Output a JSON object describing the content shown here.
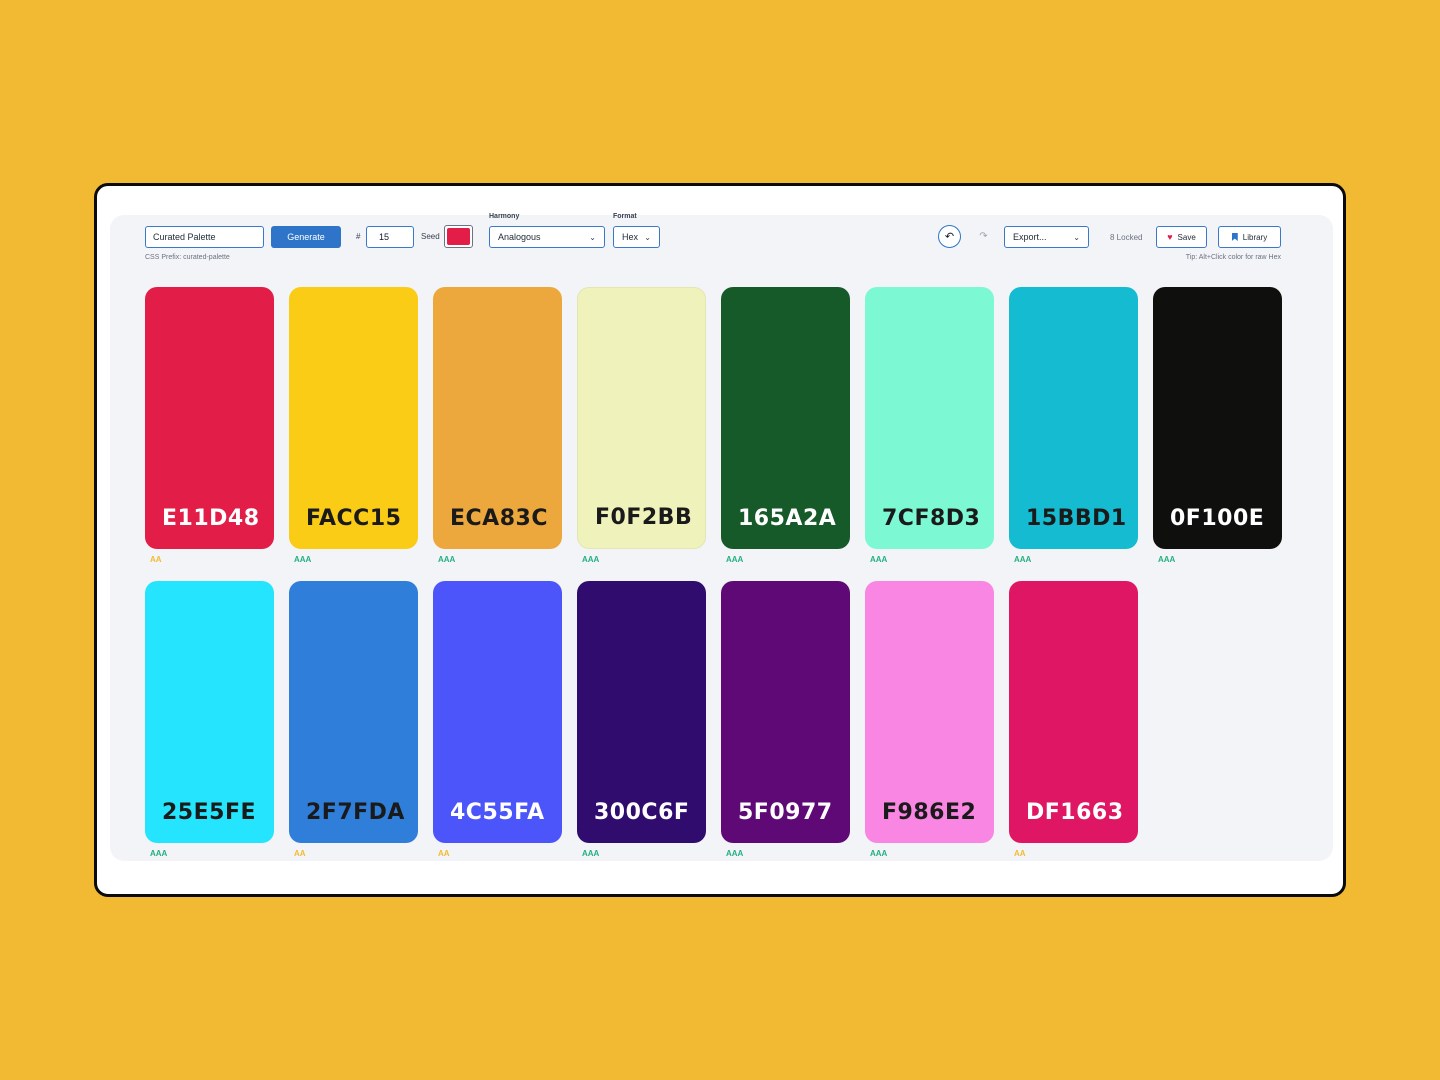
{
  "toolbar": {
    "name_value": "Curated Palette",
    "prefix_note": "CSS Prefix: curated-palette",
    "generate_label": "Generate",
    "count_label": "#",
    "count_value": "15",
    "seed_label": "Seed",
    "seed_color": "#E11D48",
    "harmony_label": "Harmony",
    "harmony_value": "Analogous",
    "format_label": "Format",
    "format_value": "Hex",
    "export_value": "Export...",
    "locked_text": "8 Locked",
    "save_label": "Save",
    "library_label": "Library",
    "tip": "Tip: Alt+Click color for raw Hex"
  },
  "colors": {
    "accent": "#2E74C9",
    "aa_color": "#F2BA33",
    "aaa_color": "#22B07D"
  },
  "swatches": [
    {
      "hex": "E11D48",
      "color": "#E11D48",
      "text_color": "#ffffff",
      "rating": "AA"
    },
    {
      "hex": "FACC15",
      "color": "#FACC15",
      "text_color": "#1a1a1a",
      "rating": "AAA"
    },
    {
      "hex": "ECA83C",
      "color": "#ECA83C",
      "text_color": "#1a1a1a",
      "rating": "AAA"
    },
    {
      "hex": "F0F2BB",
      "color": "#F0F2BB",
      "text_color": "#1a1a1a",
      "rating": "AAA"
    },
    {
      "hex": "165A2A",
      "color": "#165A2A",
      "text_color": "#ffffff",
      "rating": "AAA"
    },
    {
      "hex": "7CF8D3",
      "color": "#7CF8D3",
      "text_color": "#1a1a1a",
      "rating": "AAA"
    },
    {
      "hex": "15BBD1",
      "color": "#15BBD1",
      "text_color": "#1a1a1a",
      "rating": "AAA"
    },
    {
      "hex": "0F100E",
      "color": "#0F100E",
      "text_color": "#ffffff",
      "rating": "AAA"
    },
    {
      "hex": "25E5FE",
      "color": "#25E5FE",
      "text_color": "#1a1a1a",
      "rating": "AAA"
    },
    {
      "hex": "2F7FDA",
      "color": "#2F7FDA",
      "text_color": "#1a1a1a",
      "rating": "AA"
    },
    {
      "hex": "4C55FA",
      "color": "#4C55FA",
      "text_color": "#ffffff",
      "rating": "AA"
    },
    {
      "hex": "300C6F",
      "color": "#300C6F",
      "text_color": "#ffffff",
      "rating": "AAA"
    },
    {
      "hex": "5F0977",
      "color": "#5F0977",
      "text_color": "#ffffff",
      "rating": "AAA"
    },
    {
      "hex": "F986E2",
      "color": "#F986E2",
      "text_color": "#1a1a1a",
      "rating": "AAA"
    },
    {
      "hex": "DF1663",
      "color": "#DF1663",
      "text_color": "#ffffff",
      "rating": "AA"
    }
  ]
}
